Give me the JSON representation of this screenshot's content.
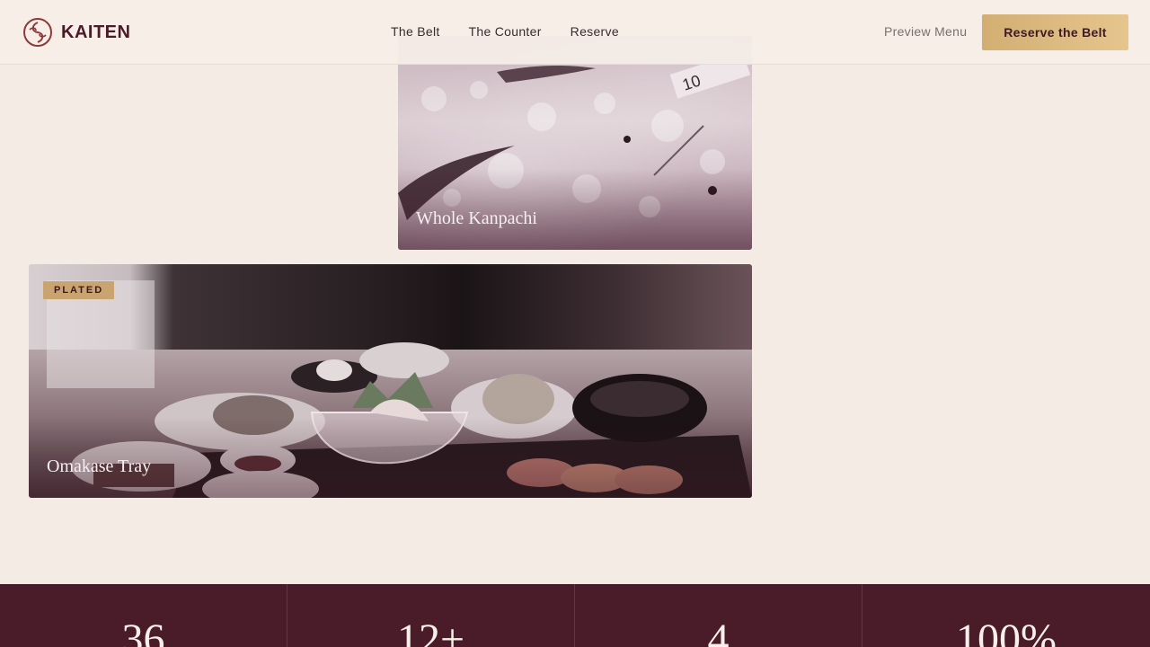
{
  "brand": {
    "name": "KAITEN",
    "logo_icon": "spiral-logo-icon",
    "accent": "#4a1c29",
    "gold": "#d2ae72"
  },
  "nav": {
    "items": [
      {
        "label": "The Belt"
      },
      {
        "label": "The Counter"
      },
      {
        "label": "Reserve"
      }
    ],
    "preview_label": "Preview Menu",
    "cta_label": "Reserve the Belt"
  },
  "gallery": {
    "cards": [
      {
        "caption": "Whole Kanpachi",
        "tag": ""
      },
      {
        "caption": "Omakase Tray",
        "tag": "PLATED"
      }
    ]
  },
  "stats": [
    {
      "value": "36"
    },
    {
      "value": "12+"
    },
    {
      "value": "4"
    },
    {
      "value": "100%"
    }
  ]
}
